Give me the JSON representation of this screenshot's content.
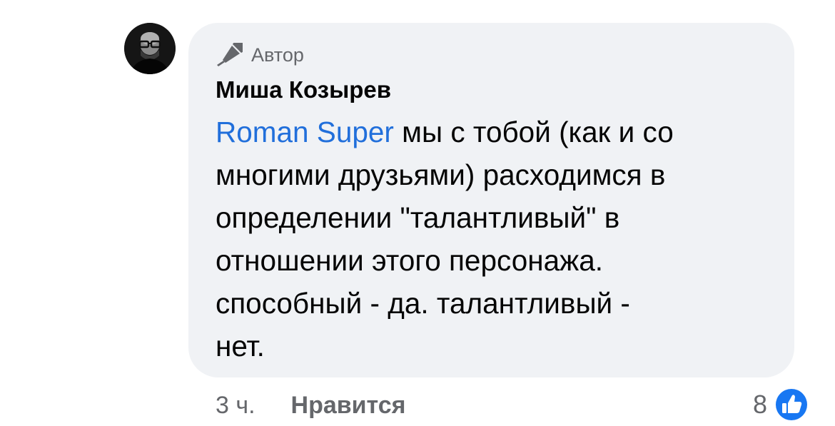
{
  "author": {
    "badge_label": "Автор",
    "badge_icon": "microphone-icon",
    "name": "Миша Козырев"
  },
  "comment": {
    "mention": "Roman Super",
    "line1_rest": " мы с тобой (как и со",
    "line2": "многими друзьями) расходимся в",
    "line3": "определении \"талантливый\" в",
    "line4": "отношении этого персонажа.",
    "line5": "способный - да. талантливый -",
    "line6": "нет."
  },
  "meta": {
    "time": "3 ч.",
    "like_label": "Нравится"
  },
  "reactions": {
    "count": "8",
    "icon": "like-thumb-icon",
    "color": "#1877f2"
  },
  "colors": {
    "bubble": "#f0f2f5",
    "mention": "#216fdb",
    "secondary_text": "#65676b"
  }
}
